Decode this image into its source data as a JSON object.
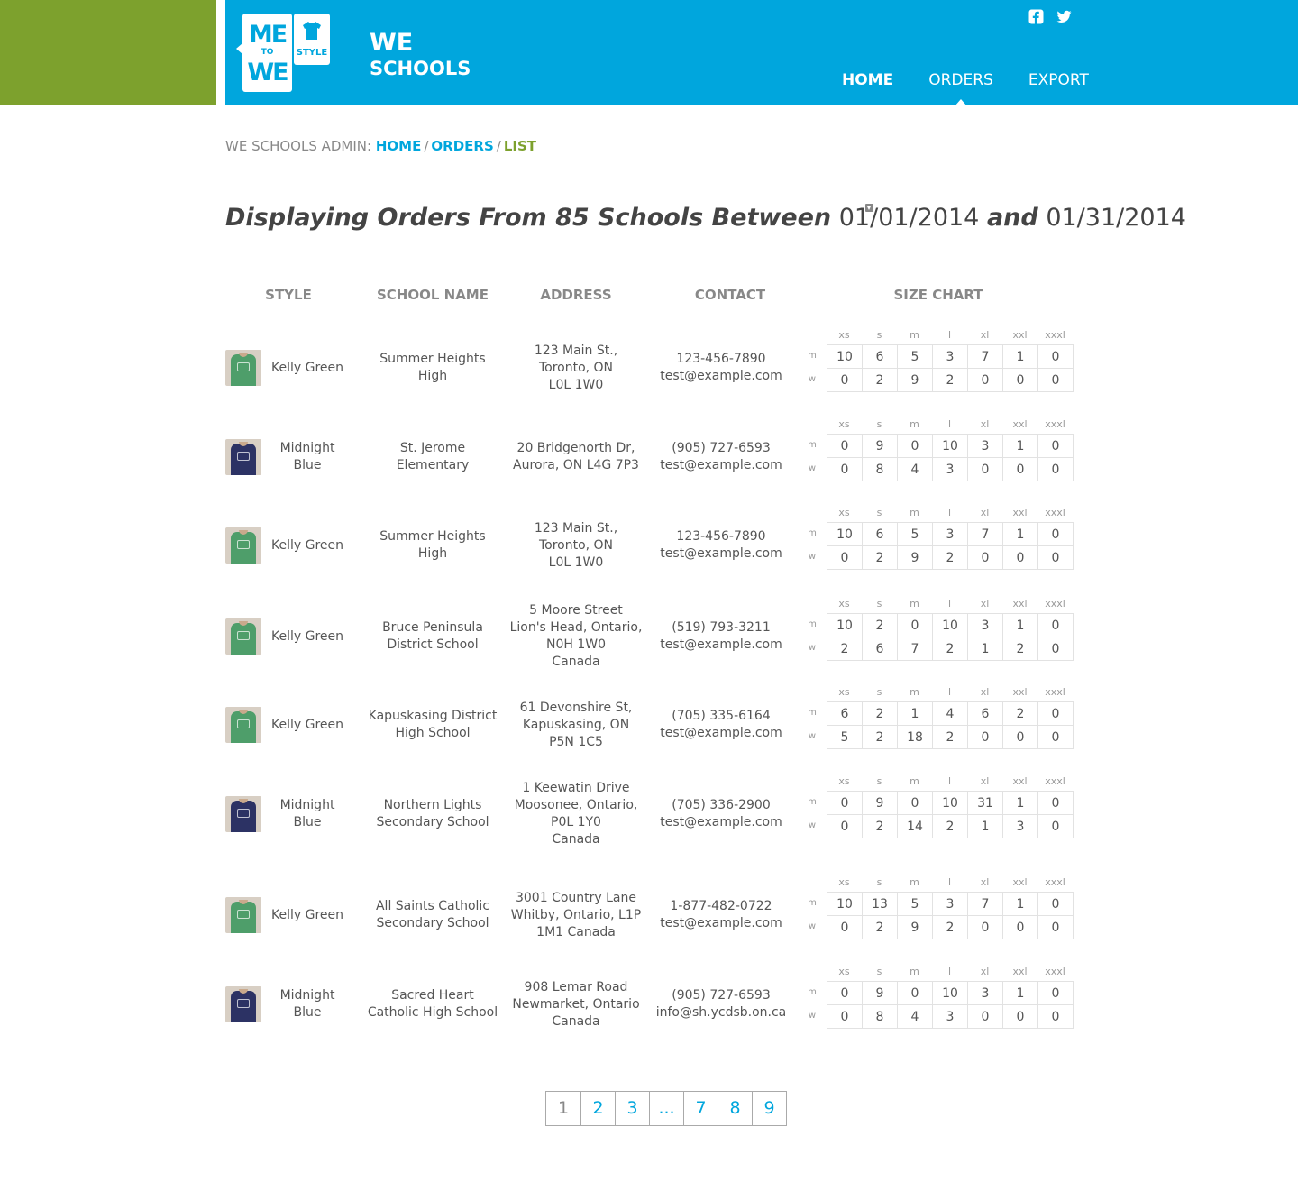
{
  "header": {
    "logo_line1": "ME",
    "logo_to": "TO",
    "logo_line2": "WE",
    "logo_style": "STYLE",
    "brand_line1": "WE",
    "brand_line2": "SCHOOLS",
    "social": [
      "facebook-icon",
      "twitter-icon"
    ],
    "nav": [
      {
        "label": "HOME"
      },
      {
        "label": "ORDERS"
      },
      {
        "label": "EXPORT"
      }
    ],
    "colors": {
      "accent_blue": "#00a6dd",
      "accent_green": "#7da12d"
    }
  },
  "breadcrumb": {
    "prefix": "WE SCHOOLS ADMIN:",
    "home": "HOME",
    "orders": "ORDERS",
    "current": "LIST",
    "sep": "/"
  },
  "heading": {
    "prefix": "Displaying Orders From 85 Schools Between",
    "start_date": "01/01/2014",
    "and": "and",
    "end_date": "01/31/2014"
  },
  "table": {
    "headers": {
      "style": "STYLE",
      "school": "SCHOOL NAME",
      "address": "ADDRESS",
      "contact": "CONTACT",
      "sizes": "SIZE CHART"
    },
    "size_labels": [
      "xs",
      "s",
      "m",
      "l",
      "xl",
      "xxl",
      "xxxl"
    ],
    "row_labels": [
      "m",
      "w"
    ],
    "rows": [
      {
        "style": "Kelly Green",
        "shirt_color": "#4e9e6a",
        "school": "Summer Heights\nHigh",
        "address": "123 Main St.,\nToronto, ON\nL0L 1W0",
        "contact": "123-456-7890\ntest@example.com",
        "m": [
          10,
          6,
          5,
          3,
          7,
          1,
          0
        ],
        "w": [
          0,
          2,
          9,
          2,
          0,
          0,
          0
        ]
      },
      {
        "style": "Midnight\nBlue",
        "shirt_color": "#2c3264",
        "school": "St. Jerome\nElementary",
        "address": "20 Bridgenorth Dr,\nAurora, ON L4G 7P3",
        "contact": "(905) 727-6593\ntest@example.com",
        "m": [
          0,
          9,
          0,
          10,
          3,
          1,
          0
        ],
        "w": [
          0,
          8,
          4,
          3,
          0,
          0,
          0
        ]
      },
      {
        "style": "Kelly Green",
        "shirt_color": "#4e9e6a",
        "school": "Summer Heights\nHigh",
        "address": "123 Main St.,\nToronto, ON\nL0L 1W0",
        "contact": "123-456-7890\ntest@example.com",
        "m": [
          10,
          6,
          5,
          3,
          7,
          1,
          0
        ],
        "w": [
          0,
          2,
          9,
          2,
          0,
          0,
          0
        ]
      },
      {
        "style": "Kelly Green",
        "shirt_color": "#4e9e6a",
        "school": "Bruce Peninsula\nDistrict School",
        "address": "5 Moore Street\nLion's Head, Ontario,\nN0H 1W0\nCanada",
        "contact": "(519) 793-3211\ntest@example.com",
        "m": [
          10,
          2,
          0,
          10,
          3,
          1,
          0
        ],
        "w": [
          2,
          6,
          7,
          2,
          1,
          2,
          0
        ]
      },
      {
        "style": "Kelly Green",
        "shirt_color": "#4e9e6a",
        "school": "Kapuskasing District\nHigh School",
        "address": "61 Devonshire St,\nKapuskasing, ON\nP5N 1C5",
        "contact": "(705) 335-6164\ntest@example.com",
        "m": [
          6,
          2,
          1,
          4,
          6,
          2,
          0
        ],
        "w": [
          5,
          2,
          18,
          2,
          0,
          0,
          0
        ]
      },
      {
        "style": "Midnight\nBlue",
        "shirt_color": "#2c3264",
        "school": "Northern Lights\nSecondary School",
        "address": "1 Keewatin Drive\nMoosonee, Ontario,\nP0L 1Y0\nCanada",
        "contact": "(705) 336-2900\ntest@example.com",
        "m": [
          0,
          9,
          0,
          10,
          31,
          1,
          0
        ],
        "w": [
          0,
          2,
          14,
          2,
          1,
          3,
          0
        ]
      },
      {
        "style": "Kelly Green",
        "shirt_color": "#4e9e6a",
        "school": "All Saints Catholic\nSecondary School",
        "address": "3001 Country Lane\nWhitby, Ontario, L1P\n1M1 Canada",
        "contact": "1-877-482-0722\ntest@example.com",
        "m": [
          10,
          13,
          5,
          3,
          7,
          1,
          0
        ],
        "w": [
          0,
          2,
          9,
          2,
          0,
          0,
          0
        ]
      },
      {
        "style": "Midnight\nBlue",
        "shirt_color": "#2c3264",
        "school": "Sacred Heart\nCatholic High School",
        "address": "908 Lemar Road\nNewmarket, Ontario\nCanada",
        "contact": "(905) 727-6593\ninfo@sh.ycdsb.on.ca",
        "m": [
          0,
          9,
          0,
          10,
          3,
          1,
          0
        ],
        "w": [
          0,
          8,
          4,
          3,
          0,
          0,
          0
        ]
      }
    ]
  },
  "pagination": {
    "current": "1",
    "pages": [
      "2",
      "3",
      "...",
      "7",
      "8",
      "9"
    ]
  }
}
